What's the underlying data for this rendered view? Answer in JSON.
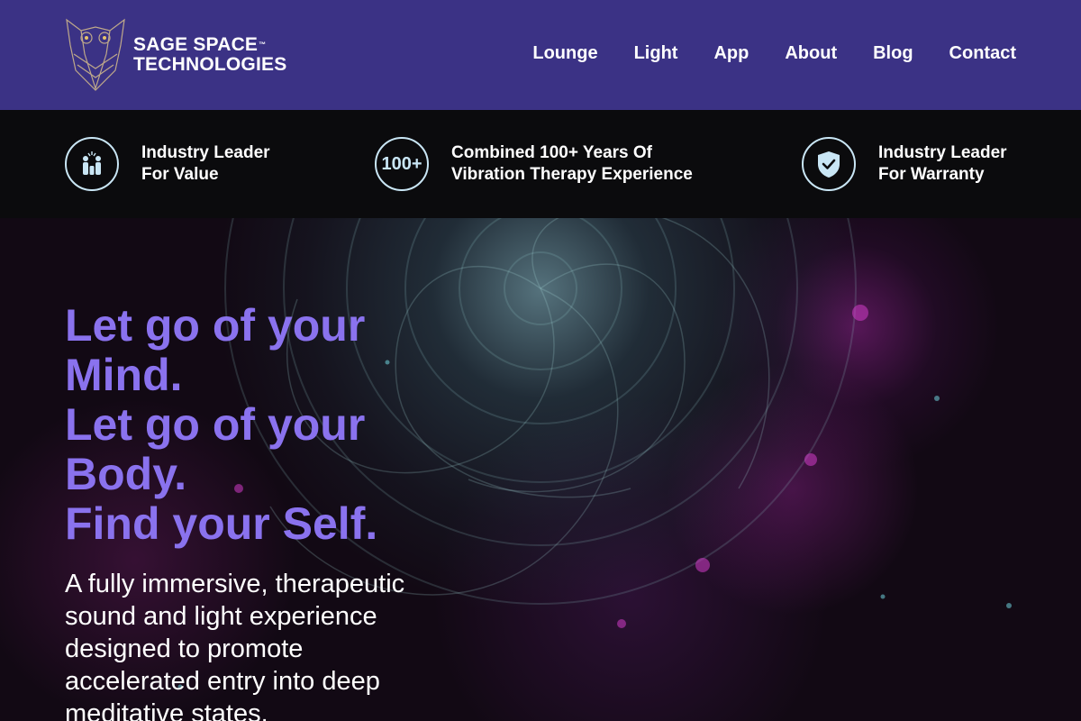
{
  "header": {
    "brand_line1": "SAGE SPACE",
    "brand_tm": "™",
    "brand_line2": "TECHNOLOGIES",
    "nav": [
      "Lounge",
      "Light",
      "App",
      "About",
      "Blog",
      "Contact"
    ]
  },
  "features": [
    {
      "icon": "people-icon",
      "badge_text": "",
      "line1": "Industry Leader",
      "line2": "For Value"
    },
    {
      "icon": "hundred-plus-icon",
      "badge_text": "100+",
      "line1": "Combined 100+ Years Of",
      "line2": "Vibration Therapy Experience"
    },
    {
      "icon": "shield-check-icon",
      "badge_text": "",
      "line1": "Industry Leader",
      "line2": "For Warranty"
    }
  ],
  "hero": {
    "headline": [
      "Let go of your",
      "Mind.",
      "Let go of your",
      "Body.",
      "Find your Self."
    ],
    "subtext": [
      "A fully immersive, therapeutic",
      "sound and light experience",
      "designed to promote",
      "accelerated entry into deep",
      "meditative states."
    ]
  },
  "colors": {
    "header_bg": "#3b3285",
    "feature_bar_bg": "#0b0b0d",
    "headline": "#8a72ee",
    "icon_ring": "#c9e6f5"
  }
}
